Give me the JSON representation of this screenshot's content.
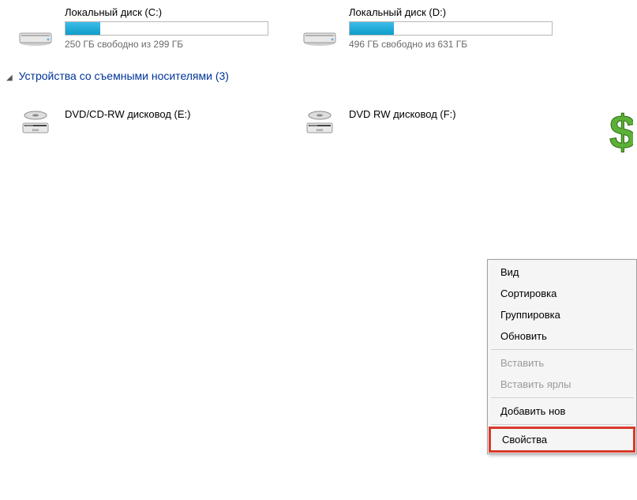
{
  "drives": [
    {
      "name": "Локальный диск (C:)",
      "space_text": "250 ГБ свободно из 299 ГБ",
      "fill_percent": 17
    },
    {
      "name": "Локальный диск (D:)",
      "space_text": "496 ГБ свободно из 631 ГБ",
      "fill_percent": 22
    }
  ],
  "section_removable": "Устройства со съемными носителями (3)",
  "removable": [
    {
      "name": "DVD/CD-RW дисковод (E:)"
    },
    {
      "name": "DVD RW дисковод (F:)"
    }
  ],
  "context_menu": {
    "view": "Вид",
    "sort": "Сортировка",
    "group": "Группировка",
    "refresh": "Обновить",
    "paste": "Вставить",
    "paste_shortcut": "Вставить ярлы",
    "add_new": "Добавить нов",
    "properties": "Свойства"
  }
}
